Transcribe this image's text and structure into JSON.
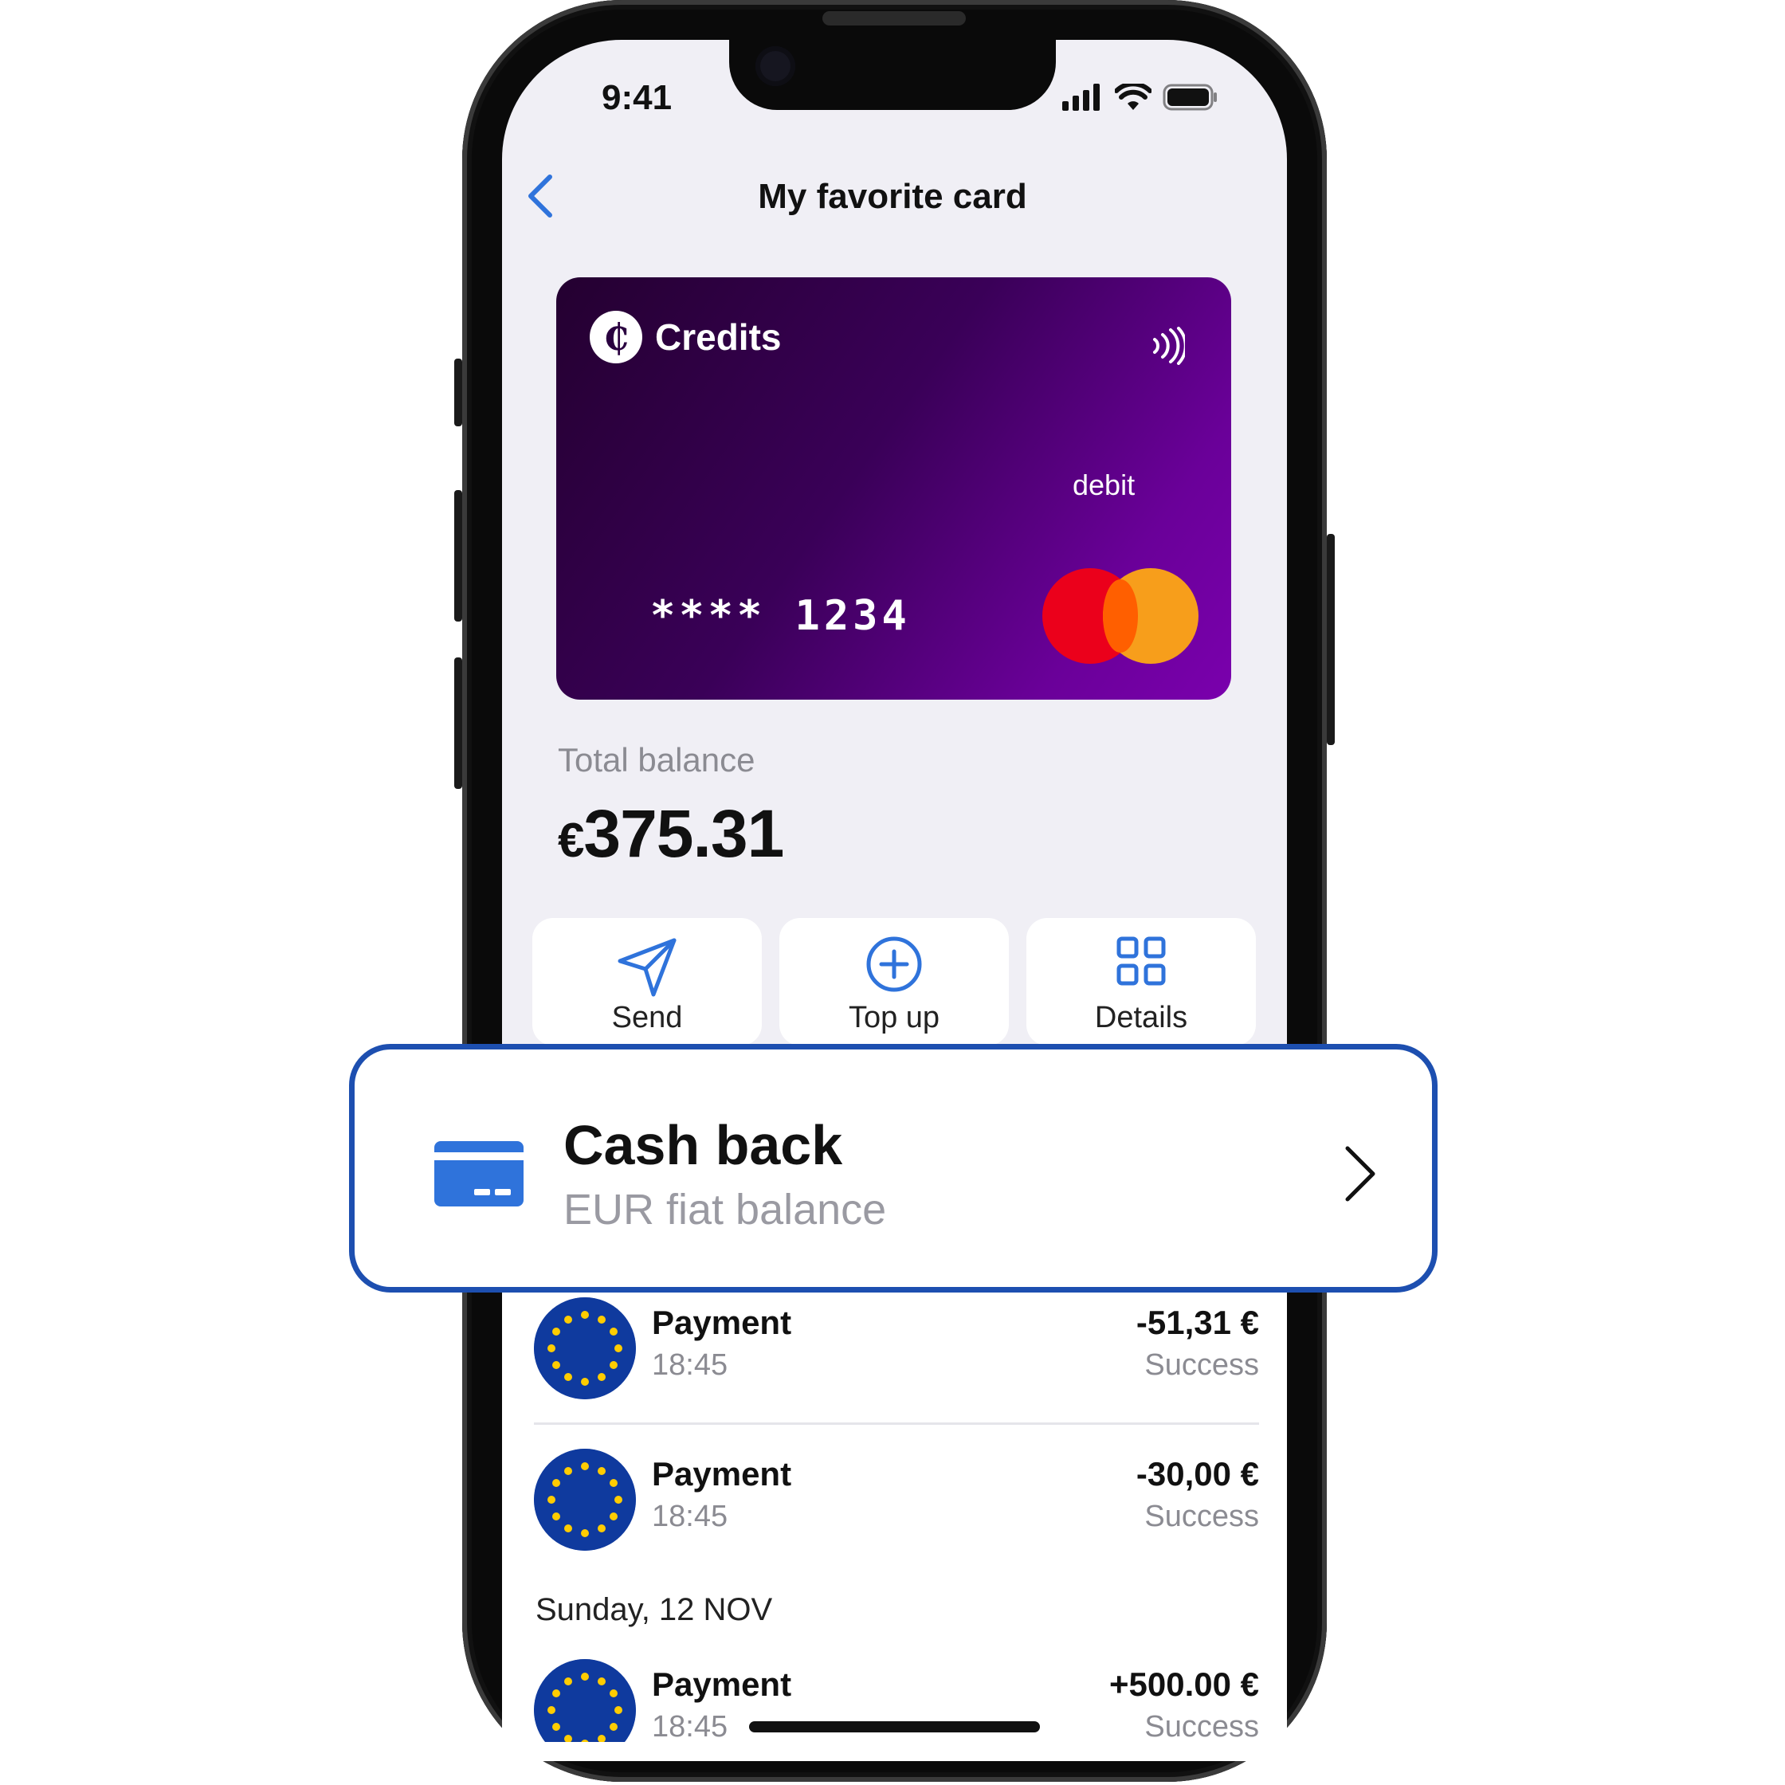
{
  "status_bar": {
    "time": "9:41"
  },
  "header": {
    "title": "My favorite card",
    "back_icon": "chevron-left-icon"
  },
  "card": {
    "brand": "Credits",
    "logo_glyph": "₵",
    "type": "debit",
    "number": "**** 1234",
    "network": "mastercard",
    "gradient_start": "#240030",
    "gradient_end": "#7a00ad"
  },
  "balance": {
    "label": "Total balance",
    "currency": "€",
    "amount": "375.31"
  },
  "actions": [
    {
      "label": "Send",
      "icon": "send-icon"
    },
    {
      "label": "Top up",
      "icon": "plus-circle-icon"
    },
    {
      "label": "Details",
      "icon": "grid-icon"
    }
  ],
  "callout": {
    "title": "Cash back",
    "subtitle": "EUR fiat balance",
    "icon": "credit-card-icon",
    "border_color": "#1d4fb0",
    "accent_color": "#2f73db"
  },
  "transactions": [
    {
      "title": "Payment",
      "time": "18:45",
      "amount": "-51,31 €",
      "status": "Success"
    },
    {
      "title": "Payment",
      "time": "18:45",
      "amount": "-30,00 €",
      "status": "Success"
    }
  ],
  "date_section": "Sunday, 12 NOV",
  "transactions_after_date": [
    {
      "title": "Payment",
      "time": "18:45",
      "amount": "+500.00 €",
      "status": "Success"
    }
  ],
  "accent_color": "#2f73db"
}
